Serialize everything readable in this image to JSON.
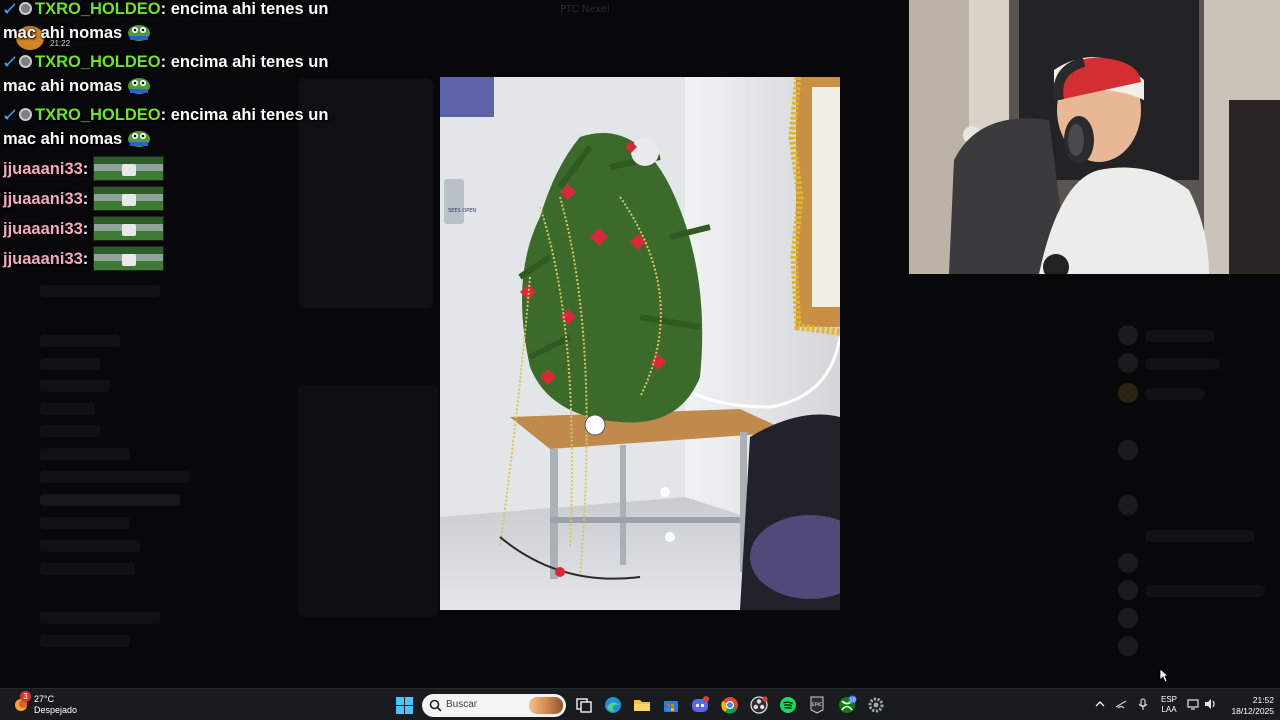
{
  "background": {
    "channel_title": "PTC Nexel"
  },
  "chat": {
    "overlay_time": "21:22",
    "messages": [
      {
        "user": "TXRO_HOLDEO",
        "text": ": encima ahi tenes un",
        "text2": "mac ahi nomas",
        "emote": "pepe-icon"
      },
      {
        "user": "TXRO_HOLDEO",
        "text": ": encima ahi tenes un",
        "text2": "mac ahi nomas",
        "emote": "pepe-icon"
      },
      {
        "user": "TXRO_HOLDEO",
        "text": ": encima ahi tenes un",
        "text2": "mac ahi nomas",
        "emote": "pepe-icon"
      },
      {
        "user": "jjuaaani33",
        "text": ":",
        "emote": "image-emote"
      },
      {
        "user": "jjuaaani33",
        "text": ":",
        "emote": "image-emote"
      },
      {
        "user": "jjuaaani33",
        "text": ":",
        "emote": "image-emote"
      },
      {
        "user": "jjuaaani33",
        "text": ":",
        "emote": "image-emote"
      }
    ],
    "colors": {
      "green_user": "#6fe22a",
      "pink_user": "#f7a9c3"
    }
  },
  "photo": {
    "subject": "christmas-tree-photo",
    "sign_text": "SEES OPEN"
  },
  "webcam": {
    "subject": "streamer-webcam"
  },
  "taskbar": {
    "weather": {
      "badge": "3",
      "temp": "27°C",
      "desc": "Despejado"
    },
    "search_placeholder": "Buscar",
    "apps": [
      "task-view-icon",
      "edge-icon",
      "file-explorer-icon",
      "store-icon",
      "discord-icon",
      "chrome-icon",
      "obs-icon",
      "spotify-icon",
      "epic-icon",
      "xbox-icon",
      "settings-icon"
    ],
    "badges": {
      "discord": "",
      "xbox": "10"
    },
    "language": {
      "line1": "ESP",
      "line2": "LAA"
    },
    "clock": {
      "time": "21:52",
      "date": "18/12/2025"
    }
  }
}
